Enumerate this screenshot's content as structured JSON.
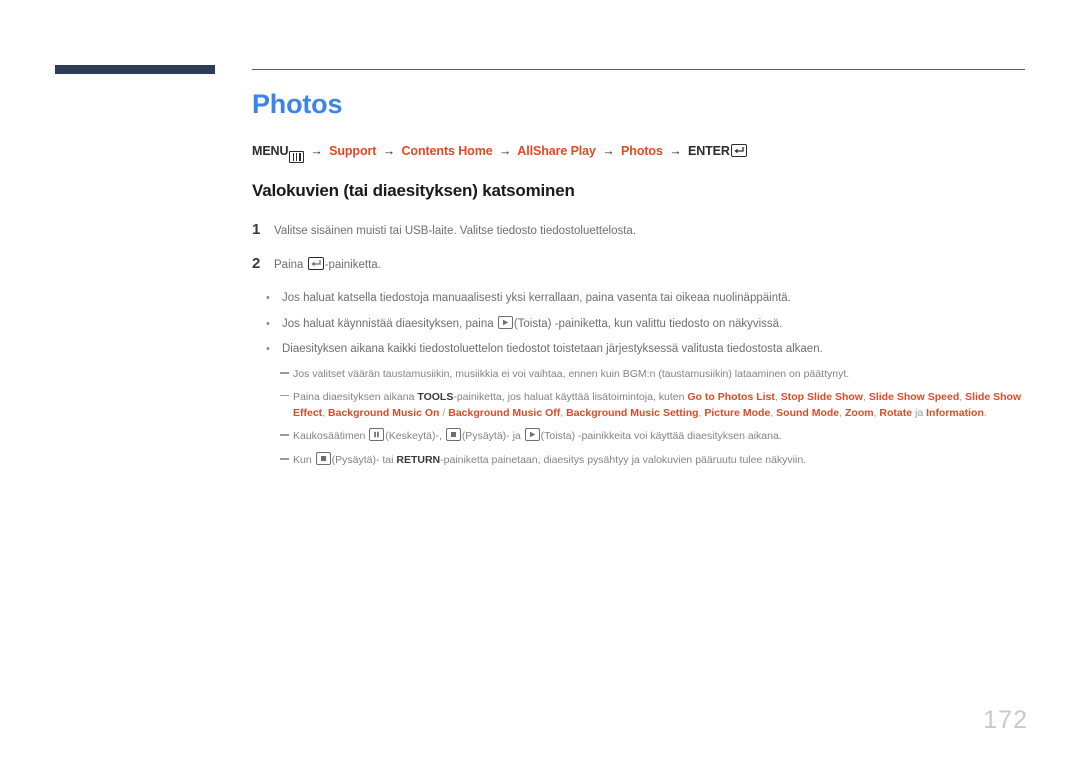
{
  "page": {
    "number": "172",
    "title": "Photos"
  },
  "breadcrumb": {
    "menu_label": "MENU",
    "menu_icon": "menu-bars-icon",
    "arrow": "→",
    "items": [
      {
        "label": "Support"
      },
      {
        "label": "Contents Home"
      },
      {
        "label": "AllShare Play"
      },
      {
        "label": "Photos"
      }
    ],
    "enter_label": "ENTER",
    "enter_icon": "enter-key-icon"
  },
  "section": {
    "heading": "Valokuvien (tai diaesityksen) katsominen"
  },
  "steps": [
    {
      "number": "1",
      "text": "Valitse sisäinen muisti tai USB-laite. Valitse tiedosto tiedostoluettelosta."
    },
    {
      "number": "2",
      "text_before": "Paina ",
      "icon": "enter-key-icon",
      "text_after": "-painiketta."
    }
  ],
  "bullets": [
    {
      "marker": "•",
      "text": "Jos haluat katsella tiedostoja manuaalisesti yksi kerrallaan, paina vasenta tai oikeaa nuolinäppäintä."
    },
    {
      "marker": "•",
      "text_before": "Jos haluat käynnistää diaesityksen, paina ",
      "icon": "play-key-icon",
      "text_after": "(Toista) -painiketta, kun valittu tiedosto on näkyvissä."
    },
    {
      "marker": "•",
      "text": "Diaesityksen aikana kaikki tiedostoluettelon tiedostot toistetaan järjestyksessä valitusta tiedostosta alkaen."
    }
  ],
  "notes": [
    {
      "text": "Jos valitset väärän taustamusiikin, musiikkia ei voi vaihtaa, ennen kuin BGM:n (taustamusiikin) lataaminen on päättynyt."
    },
    {
      "text_before": "Paina diaesityksen aikana ",
      "bold": "TOOLS",
      "text_mid": "-painiketta, jos haluat käyttää lisätoimintoja, kuten ",
      "menu_items": [
        "Go to Photos List",
        "Stop Slide Show",
        "Slide Show Speed",
        "Slide Show Effect",
        "Background Music On",
        "Background Music Off",
        "Background Music Setting",
        "Picture Mode",
        "Sound Mode",
        "Zoom",
        "Rotate",
        "Information"
      ],
      "separator_slash": " / ",
      "separator_comma": ", ",
      "separator_ja": " ja ",
      "text_end": "."
    },
    {
      "text_before": "Kaukosäätimen ",
      "icon1": "pause-key-icon",
      "text1": "(Keskeytä)-, ",
      "icon2": "stop-key-icon",
      "text2": "(Pysäytä)- ja ",
      "icon3": "play-key-icon",
      "text3": "(Toista) -painikkeita voi käyttää diaesityksen aikana."
    },
    {
      "text_before": "Kun ",
      "icon1": "stop-key-icon",
      "text1": "(Pysäytä)- tai ",
      "bold": "RETURN",
      "text2": "-painiketta painetaan, diaesitys pysähtyy ja valokuvien pääruutu tulee näkyviin."
    }
  ],
  "colors": {
    "title_blue": "#3d84e8",
    "accent_red": "#e04a23",
    "bar_navy": "#2e3b55",
    "body_gray": "#6d6e71",
    "page_number_gray": "#c9c9c9"
  }
}
